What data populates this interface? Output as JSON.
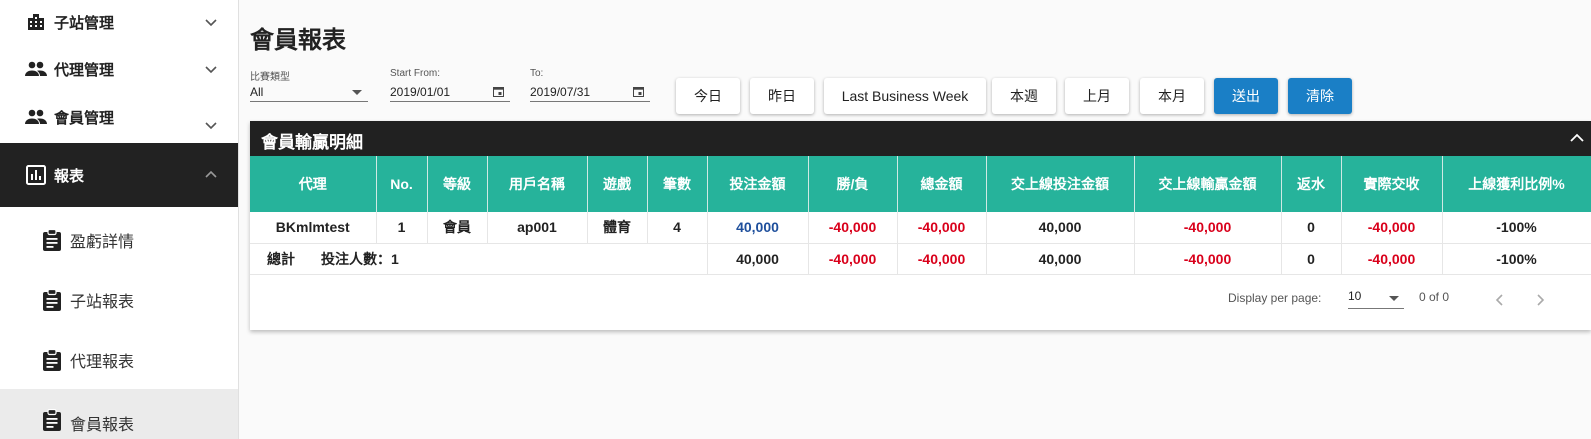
{
  "sidebar": {
    "items": [
      {
        "label": "子站管理",
        "icon": "building-icon"
      },
      {
        "label": "代理管理",
        "icon": "people-icon"
      },
      {
        "label": "會員管理",
        "icon": "people-icon"
      },
      {
        "label": "報表",
        "icon": "chart-icon"
      }
    ],
    "subitems": [
      {
        "label": "盈虧詳情",
        "icon": "clipboard-icon"
      },
      {
        "label": "子站報表",
        "icon": "clipboard-icon"
      },
      {
        "label": "代理報表",
        "icon": "clipboard-icon"
      },
      {
        "label": "會員報表",
        "icon": "clipboard-icon"
      }
    ]
  },
  "page": {
    "title": "會員報表"
  },
  "filters": {
    "game_type_label": "比賽類型",
    "game_type_value": "All",
    "start_label": "Start From:",
    "start_value": "2019/01/01",
    "to_label": "To:",
    "to_value": "2019/07/31"
  },
  "buttons": {
    "today": "今日",
    "yesterday": "昨日",
    "last_business_week": "Last Business Week",
    "this_week": "本週",
    "last_month": "上月",
    "this_month": "本月",
    "submit": "送出",
    "clear": "清除"
  },
  "card": {
    "title": "會員輸贏明細"
  },
  "table": {
    "headers": [
      "代理",
      "No.",
      "等級",
      "用戶名稱",
      "遊戲",
      "筆數",
      "投注金額",
      "勝/負",
      "總金額",
      "交上線投注金額",
      "交上線輸贏金額",
      "返水",
      "實際交收",
      "上線獲利比例%"
    ],
    "rows": [
      [
        "BKmlmtest",
        "1",
        "會員",
        "ap001",
        "體育",
        "4",
        "40,000",
        "-40,000",
        "-40,000",
        "40,000",
        "-40,000",
        "0",
        "-40,000",
        "-100%"
      ]
    ],
    "total": {
      "label": "總計",
      "bettors_label": "投注人數：1",
      "values": [
        "40,000",
        "-40,000",
        "-40,000",
        "40,000",
        "-40,000",
        "0",
        "-40,000",
        "-100%"
      ]
    }
  },
  "pagination": {
    "per_page_label": "Display per page:",
    "per_page_value": "10",
    "range": "0 of 0"
  },
  "colors": {
    "accent": "#26b39b",
    "primary_button": "#1a7fc6",
    "negative": "#d9001b",
    "header_dark": "#212121"
  }
}
